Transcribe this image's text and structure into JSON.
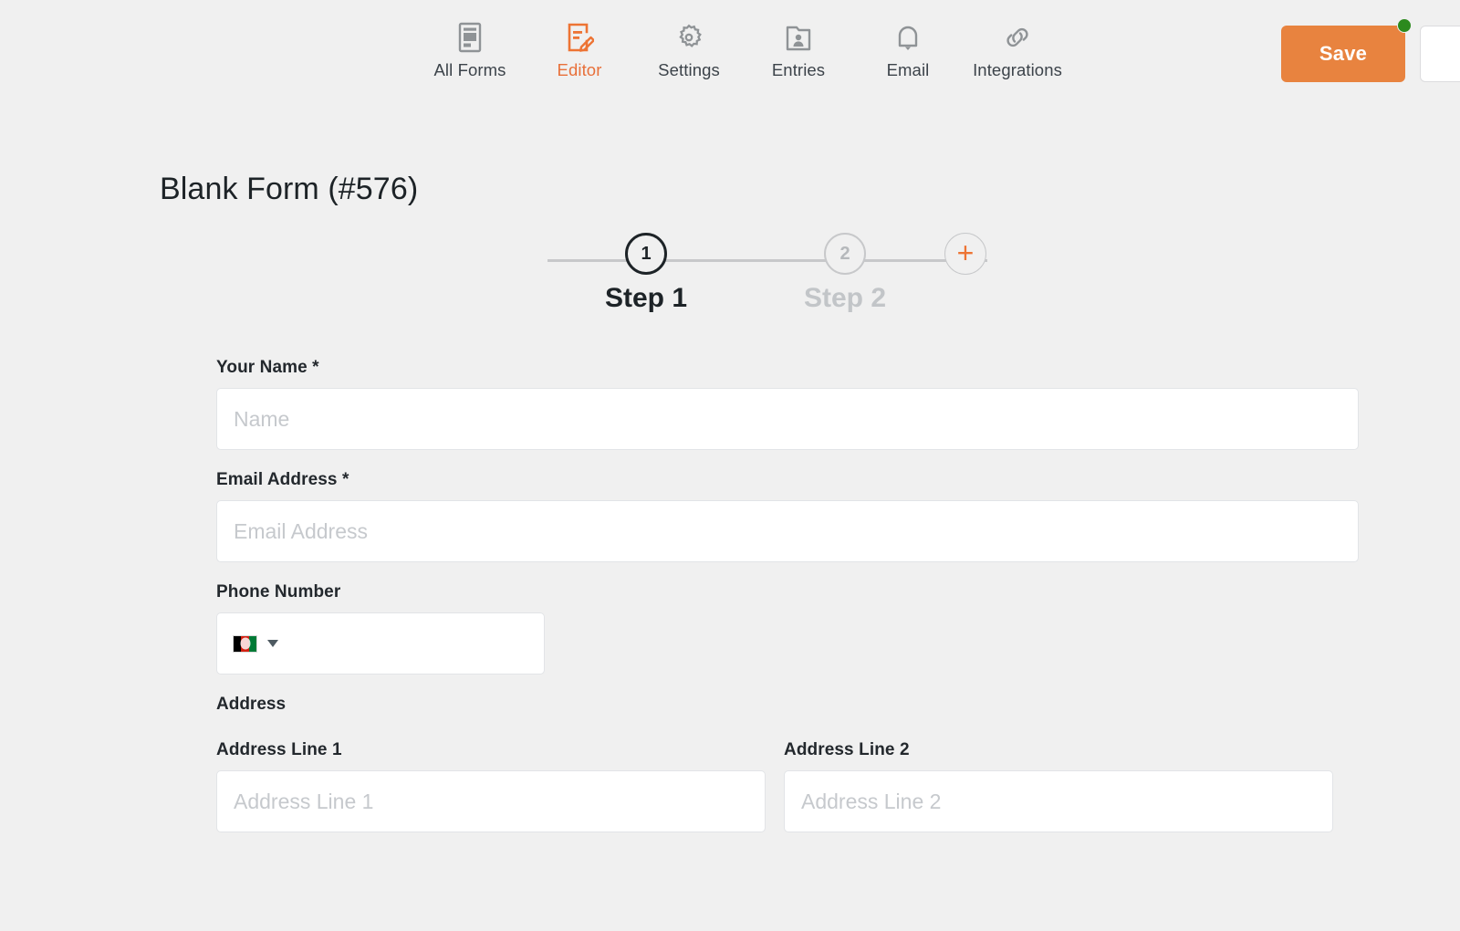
{
  "topnav": {
    "items": [
      {
        "label": "All Forms",
        "icon": "forms-list-icon",
        "active": false
      },
      {
        "label": "Editor",
        "icon": "editor-pencil-icon",
        "active": true
      },
      {
        "label": "Settings",
        "icon": "gear-icon",
        "active": false
      },
      {
        "label": "Entries",
        "icon": "entries-folder-person-icon",
        "active": false
      },
      {
        "label": "Email",
        "icon": "bell-icon",
        "active": false
      },
      {
        "label": "Integrations",
        "icon": "link-chain-icon",
        "active": false
      }
    ],
    "save_label": "Save",
    "save_color": "#e8833f",
    "status_dot_color": "#2c8a1e",
    "active_color": "#e8703a"
  },
  "page": {
    "title": "Blank Form (#576)"
  },
  "steps": {
    "nodes": [
      {
        "number": "1",
        "caption": "Step 1",
        "state": "active"
      },
      {
        "number": "2",
        "caption": "Step 2",
        "state": "inactive"
      }
    ],
    "add_step_glyph": "+",
    "add_step_color": "#ed7434"
  },
  "form": {
    "fields": [
      {
        "label": "Your Name *",
        "placeholder": "Name",
        "value": "",
        "type": "text"
      },
      {
        "label": "Email Address *",
        "placeholder": "Email Address",
        "value": "",
        "type": "email"
      },
      {
        "label": "Phone Number",
        "country_flag": "afghanistan-flag",
        "value": "",
        "type": "phone"
      }
    ],
    "address": {
      "section_label": "Address",
      "line1_label": "Address Line 1",
      "line1_placeholder": "Address Line 1",
      "line1_value": "",
      "line2_label": "Address Line 2",
      "line2_placeholder": "Address Line 2",
      "line2_value": ""
    }
  }
}
